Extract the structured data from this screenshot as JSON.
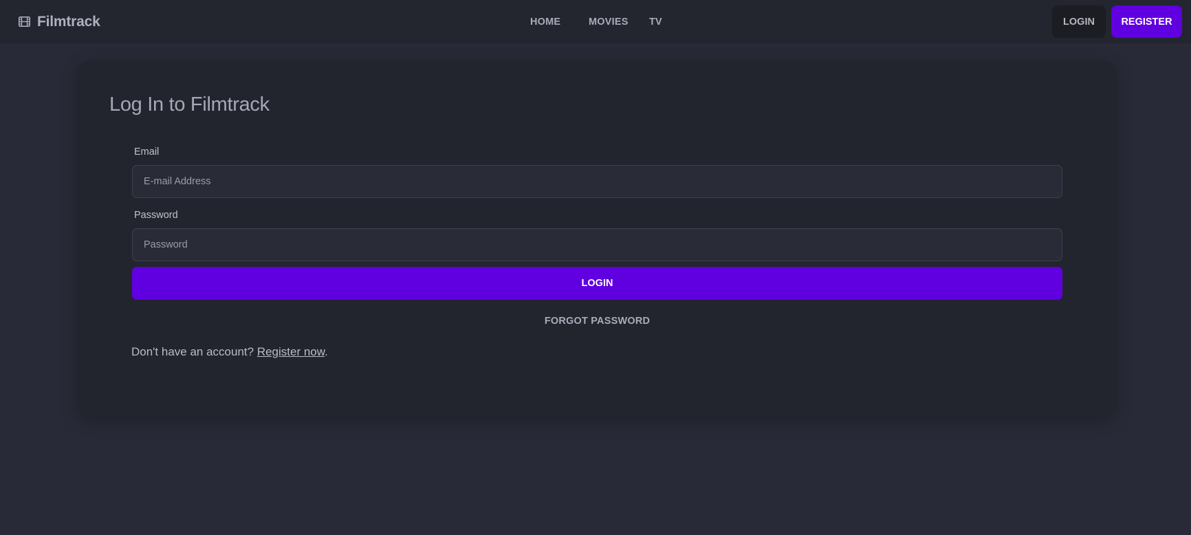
{
  "brand": {
    "name": "Filmtrack",
    "icon": "film-icon"
  },
  "nav": {
    "links": [
      {
        "label": "HOME"
      },
      {
        "label": "MOVIES"
      },
      {
        "label": "TV"
      }
    ],
    "login_label": "LOGIN",
    "register_label": "REGISTER"
  },
  "form": {
    "title": "Log In to Filmtrack",
    "email_label": "Email",
    "email_placeholder": "E-mail Address",
    "email_value": "",
    "password_label": "Password",
    "password_placeholder": "Password",
    "password_value": "",
    "submit_label": "LOGIN",
    "forgot_label": "FORGOT PASSWORD",
    "signup_prefix": "Don't have an account? ",
    "signup_link": "Register now",
    "signup_suffix": "."
  },
  "colors": {
    "background": "#282b37",
    "navbar": "#23252f",
    "card": "#22242e",
    "accent": "#6000e0"
  }
}
